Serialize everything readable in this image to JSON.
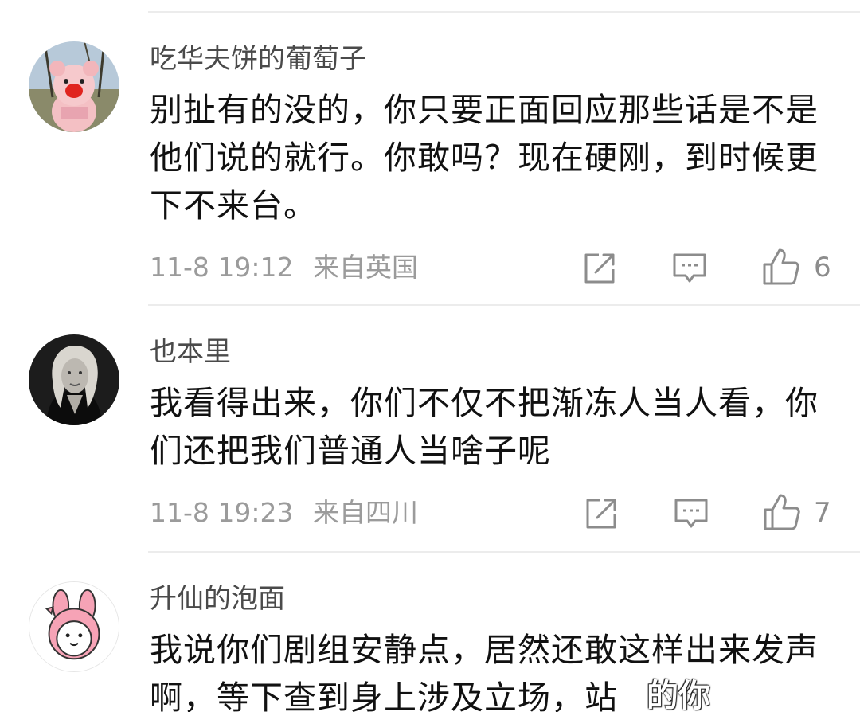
{
  "comments": [
    {
      "username": "吃华夫饼的葡萄子",
      "text": "别扯有的没的，你只要正面回应那些话是不是他们说的就行。你敢吗？现在硬刚，到时候更下不来台。",
      "time": "11-8 19:12",
      "location": "来自英国",
      "likes": "6",
      "avatar_icon": "plush-bear-avatar"
    },
    {
      "username": "也本里",
      "text": "我看得出来，你们不仅不把渐冻人当人看，你们还把我们普通人当啥子呢",
      "time": "11-8 19:23",
      "location": "来自四川",
      "likes": "7",
      "avatar_icon": "woman-portrait-avatar"
    },
    {
      "username": "升仙的泡面",
      "text": "我说你们剧组安静点，居然还敢这样出来发声啊，等下查到身上涉及立场，站",
      "avatar_icon": "pink-bunny-avatar"
    }
  ],
  "icons": {
    "share": "share-icon",
    "reply": "reply-icon",
    "like": "like-icon"
  },
  "watermark": "的你",
  "colors": {
    "text": "#111111",
    "username": "#4a4a4a",
    "meta": "#9b9b9b",
    "divider": "#ececec"
  }
}
